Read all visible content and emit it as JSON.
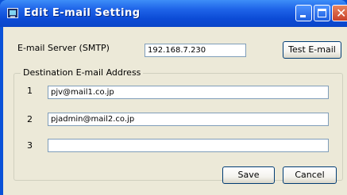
{
  "window": {
    "title": "Edit E-mail Setting",
    "icon": "app-window-icon",
    "controls": [
      "minimize-icon",
      "maximize-icon",
      "close-icon"
    ]
  },
  "smtp": {
    "label": "E-mail Server (SMTP)",
    "value": "192.168.7.230",
    "test_button": "Test E-mail"
  },
  "destination": {
    "group_label": "Destination E-mail Address",
    "rows": [
      {
        "number": "1",
        "value": "pjv@mail1.co.jp"
      },
      {
        "number": "2",
        "value": "pjadmin@mail2.co.jp"
      },
      {
        "number": "3",
        "value": ""
      }
    ]
  },
  "footer": {
    "save_label": "Save",
    "cancel_label": "Cancel"
  },
  "colors": {
    "titlebar": "#0a52d8",
    "dialog_face": "#ece9d8",
    "textbox_border": "#7f9db9",
    "close_button": "#d35a3a"
  }
}
